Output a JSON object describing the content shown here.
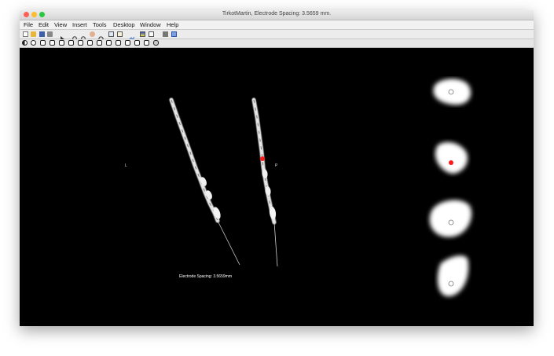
{
  "window": {
    "title": "TirkotMartin, Electrode Spacing: 3.5659 mm.",
    "traffic_colors": {
      "close": "#fe5f57",
      "minimize": "#febc2e",
      "maximize": "#28c840"
    }
  },
  "menu": [
    "File",
    "Edit",
    "View",
    "Insert",
    "Tools",
    "Desktop",
    "Window",
    "Help"
  ],
  "toolbar": {
    "icons": [
      "new-figure-icon",
      "open-file-icon",
      "save-icon",
      "print-icon",
      "edit-plot-icon",
      "zoom-in-icon",
      "zoom-out-icon",
      "pan-icon",
      "rotate-3d-icon",
      "data-cursor-icon",
      "brush-icon",
      "link-plot-icon",
      "colorbar-icon",
      "legend-icon",
      "hide-plot-tools-icon",
      "show-plot-tools-icon"
    ]
  },
  "tool_strip": {
    "icons": [
      "contrast-icon",
      "tool-btn-1-icon",
      "tool-btn-2-icon",
      "tool-btn-3-icon",
      "tool-btn-4-icon",
      "tool-btn-5-icon",
      "tool-btn-6-icon",
      "tool-btn-7-icon",
      "tool-btn-8-icon",
      "tool-btn-9-icon",
      "tool-btn-10-icon",
      "tool-btn-11-icon",
      "tool-btn-12-icon",
      "checkbox-icon",
      "view-icon"
    ]
  },
  "figure": {
    "label_left": "L",
    "label_right": "P",
    "caption": "Electrode Spacing: 3.5659mm",
    "marker_color": "#ff1a1a"
  }
}
